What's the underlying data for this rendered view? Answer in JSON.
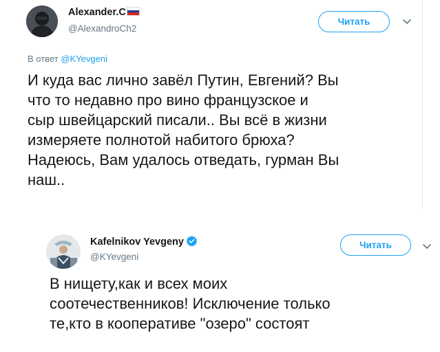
{
  "tweets": [
    {
      "name": "Alexander.C",
      "flag_colors": [
        "#ffffff",
        "#1c3f9e",
        "#d52b1e"
      ],
      "handle": "@AlexandroCh2",
      "follow_label": "Читать",
      "more_icon": "chevron-down-icon",
      "reply_prefix": "В ответ",
      "reply_mention": "@KYevgeni",
      "text_lines": [
        "И куда вас лично завёл Путин, Евгений? Вы",
        "что то недавно про вино французское и",
        "сыр швейцарский писали.. Вы всё в жизни",
        "измеряете полнотой набитого брюха?",
        "Надеюсь, Вам удалось отведать, гурман Вы",
        "наш.."
      ]
    },
    {
      "name": "Kafelnikov Yevgeny",
      "verified_icon": "verified-badge-icon",
      "verified_color": "#1da1f2",
      "handle": "@KYevgeni",
      "follow_label": "Читать",
      "more_icon": "chevron-down-icon",
      "text_lines": [
        "В нищету,как и всех моих",
        "соотечественников! Исключение только",
        "те,кто в кооперативе \"озеро\" состоят"
      ]
    }
  ],
  "colors": {
    "accent": "#1da1f2",
    "secondary_text": "#657786",
    "primary_text": "#14171a"
  }
}
